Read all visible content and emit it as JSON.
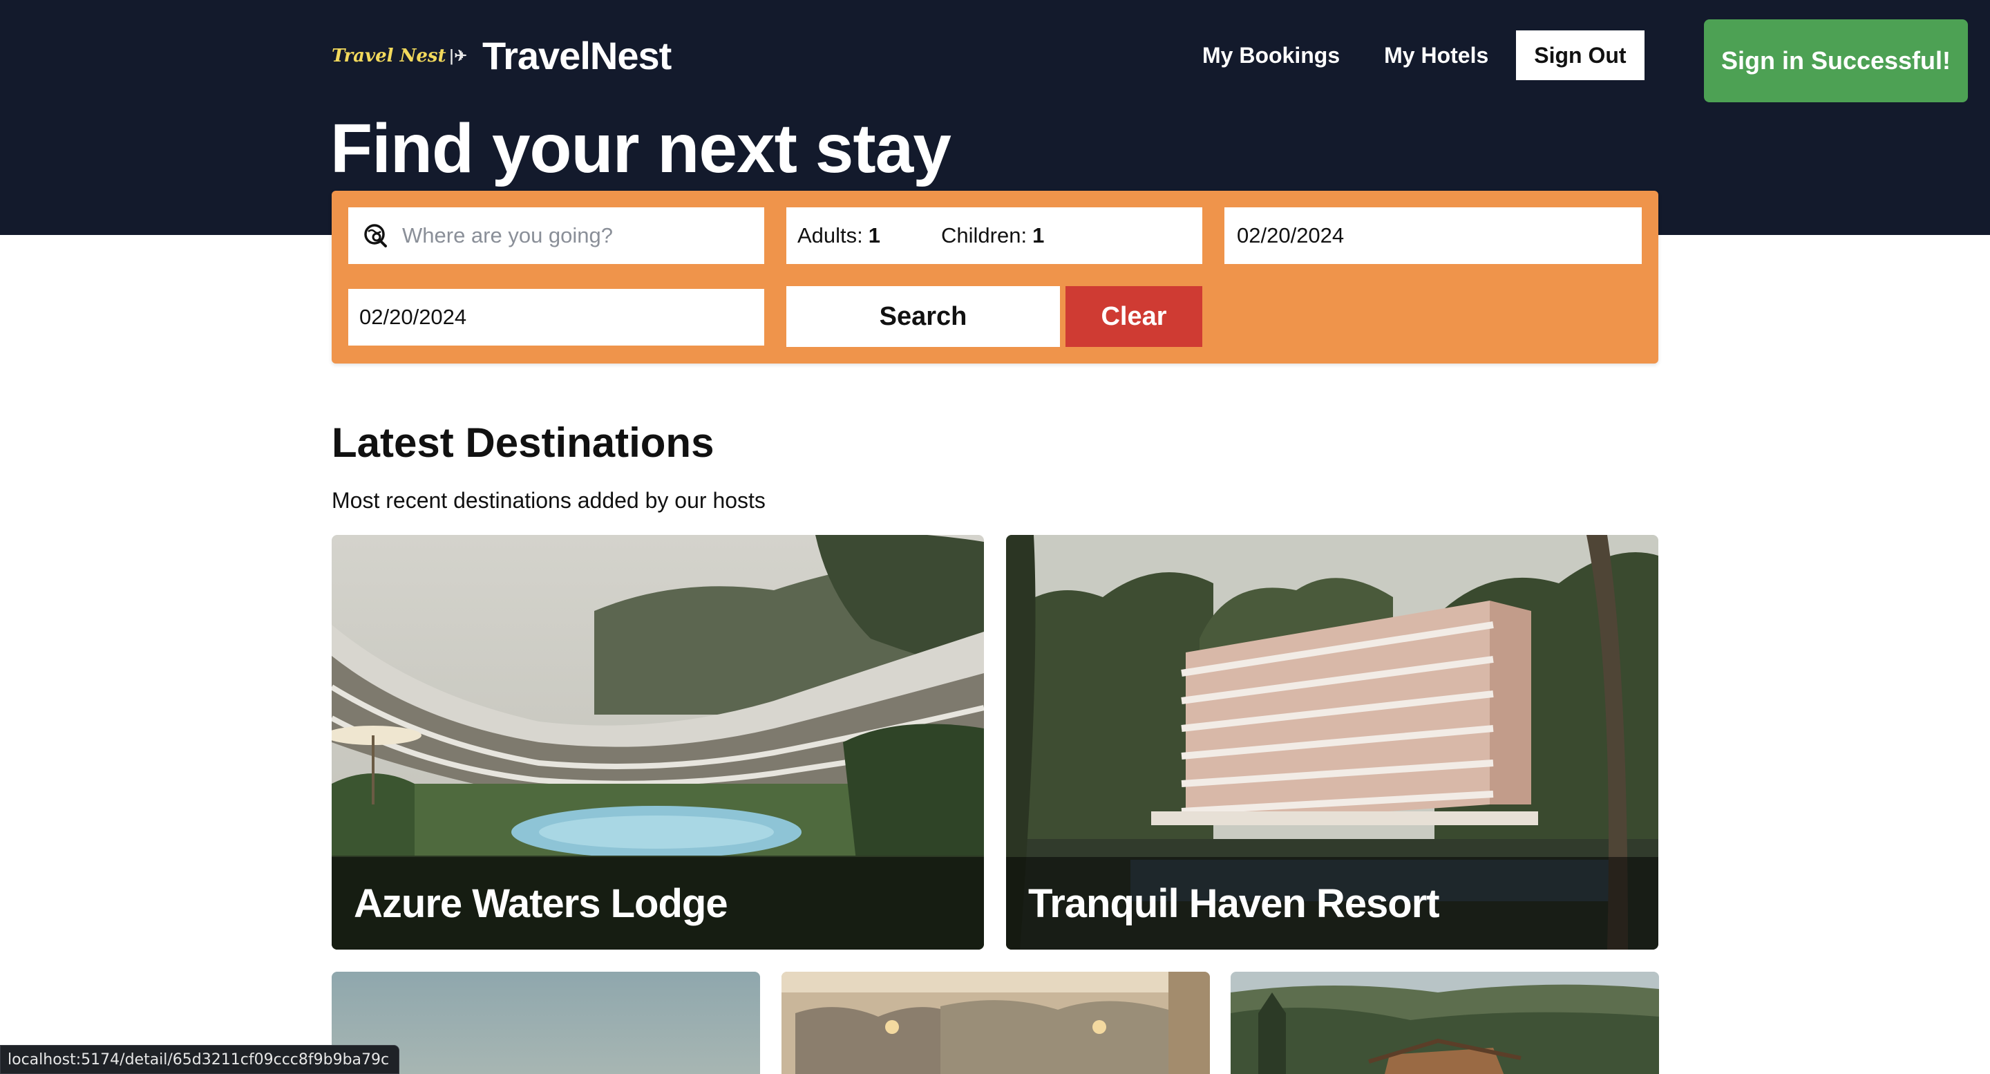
{
  "brand": {
    "logo_text": "Travel Nest",
    "title": "TravelNest"
  },
  "nav": {
    "bookings": "My Bookings",
    "hotels": "My Hotels",
    "signout": "Sign Out"
  },
  "toast": {
    "message": "Sign in Successful!"
  },
  "hero": {
    "title": "Find your next stay"
  },
  "search": {
    "destination_placeholder": "Where are you going?",
    "adults_label": "Adults:",
    "adults_value": "1",
    "children_label": "Children:",
    "children_value": "1",
    "check_in": "02/20/2024",
    "check_out": "02/20/2024",
    "search_button": "Search",
    "clear_button": "Clear"
  },
  "latest": {
    "title": "Latest Destinations",
    "subtitle": "Most recent destinations added by our hosts",
    "cards": [
      {
        "name": "Azure Waters Lodge"
      },
      {
        "name": "Tranquil Haven Resort"
      },
      {
        "name": ""
      },
      {
        "name": ""
      },
      {
        "name": ""
      }
    ]
  },
  "status_bar": {
    "url": "localhost:5174/detail/65d3211cf09ccc8f9b9ba79c"
  },
  "colors": {
    "header_bg": "#131a2c",
    "search_panel": "#ef944b",
    "clear_button": "#cf3b33",
    "toast": "#4da154",
    "logo_accent": "#f2d95c"
  }
}
